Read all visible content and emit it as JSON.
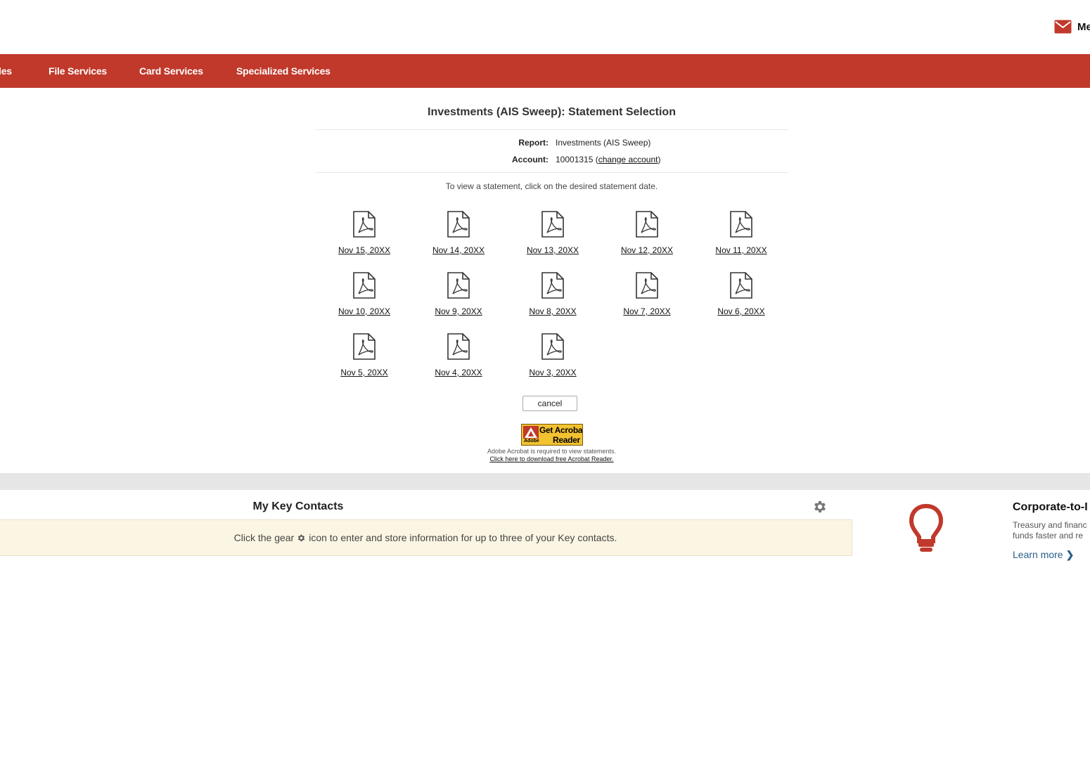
{
  "header": {
    "messages_label": "Me"
  },
  "nav": {
    "items": [
      "les",
      "File Services",
      "Card Services",
      "Specialized Services"
    ]
  },
  "main": {
    "title": "Investments (AIS Sweep): Statement Selection",
    "report_label": "Report:",
    "report_value": "Investments (AIS Sweep)",
    "account_label": "Account:",
    "account_number": "10001315",
    "account_paren_open": " (",
    "change_account": "change account",
    "account_paren_close": ")",
    "instructions": "To view a statement, click on the desired statement date.",
    "statements": [
      "Nov 15, 20XX",
      "Nov 14, 20XX",
      "Nov 13, 20XX",
      "Nov 12, 20XX",
      "Nov 11, 20XX",
      "Nov 10, 20XX",
      "Nov 9, 20XX",
      "Nov 8, 20XX",
      "Nov 7, 20XX",
      "Nov 6, 20XX",
      "Nov 5, 20XX",
      "Nov 4, 20XX",
      "Nov 3, 20XX"
    ],
    "cancel_label": "cancel",
    "acrobat": {
      "badge_line1": "Get Acrobat",
      "badge_line2": "Reader",
      "badge_brand": "Adobe",
      "note": "Adobe Acrobat is required to view statements.",
      "download_link": "Click here to download free Acrobat Reader."
    }
  },
  "contacts": {
    "title": "My Key Contacts",
    "message_before": "Click the gear",
    "message_after": "icon to enter and store information for up to three of your Key contacts."
  },
  "promo": {
    "title": "Corporate-to-I",
    "text_line1": "Treasury and financ",
    "text_line2": "funds faster and re",
    "link": "Learn more"
  },
  "colors": {
    "brand_red": "#c0392b",
    "link_blue": "#2b5f8a",
    "notice_bg": "#fbf5e3"
  },
  "icons": [
    "envelope-icon",
    "pdf-icon",
    "gear-icon",
    "lightbulb-icon",
    "chevron-right-icon"
  ]
}
